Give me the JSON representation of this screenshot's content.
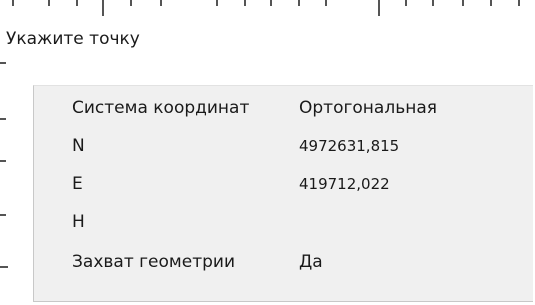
{
  "prompt": {
    "text": "Укажите точку"
  },
  "properties": {
    "rows": [
      {
        "key": "Система координат",
        "value": "Ортогональная"
      },
      {
        "key": "N",
        "value": "4972631,815"
      },
      {
        "key": "E",
        "value": "419712,022"
      },
      {
        "key": "H",
        "value": ""
      },
      {
        "key": "Захват геометрии",
        "value": "Да"
      }
    ]
  }
}
